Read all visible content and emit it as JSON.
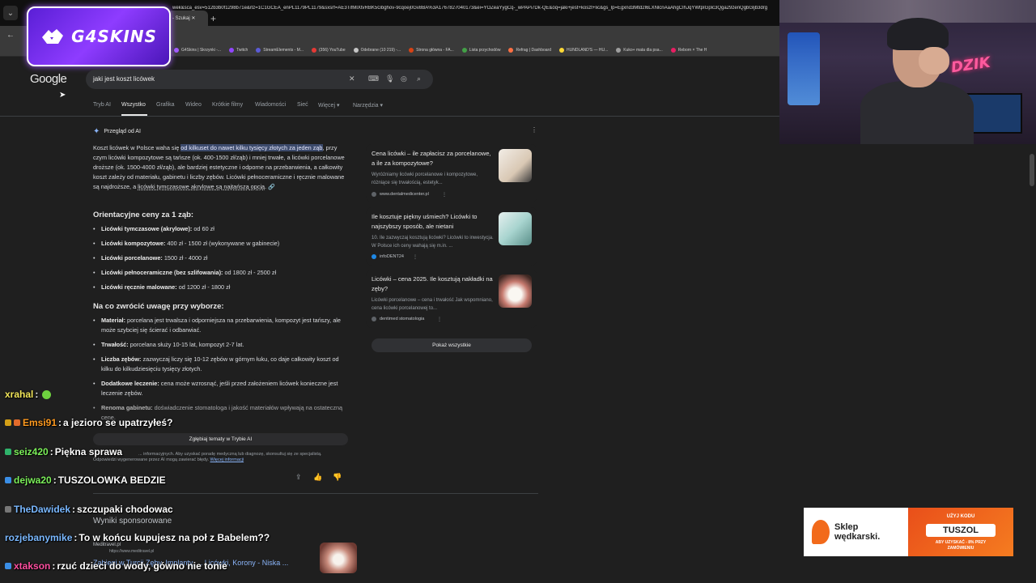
{
  "browser": {
    "tabs": [
      {
        "label": "- Szukaj"
      }
    ],
    "url": "wek&sca_esv=512b3b0f1298b71e&rlz=1C1GCEA_enPL1179PL1179&sxsrf=AE3TifMIXtvRBK5Gbghov-9cqoej0Gv8BA%3A1767827040173&ei=YOZeaYygCq-_wPAPi7Dk-QE&oq=jaki+jest+koszt+lic&gs_lp=Egxnd3Mtd2l6LXNlcnAaAhgCIhJqYWtpIGplc3Qga29zenQgbGljb3drg",
    "bookmarks": [
      "G4Skins | Skrzynki -...",
      "Twitch",
      "StreamElements - M...",
      "(356) YouTube",
      "Odebrane (10 219) -...",
      "Strona główna - FA...",
      "Lista przychodów",
      "Refrag | Dashboard",
      "HUNDLAND'S — HU...",
      "Kuko+ mata dla psa...",
      "Reborn × The H"
    ]
  },
  "overlay_brand": "G4SKINS",
  "google": {
    "logo": "Google",
    "query": "jaki jest koszt licówek",
    "tabs": [
      "Tryb AI",
      "Wszystko",
      "Grafika",
      "Wideo",
      "Krótkie filmy",
      "Wiadomości",
      "Sieć",
      "Więcej ▾",
      "Narzędzia ▾"
    ],
    "ai_overview": {
      "heading": "Przegląd od AI",
      "intro_a": "Koszt licówek w Polsce waha się ",
      "intro_hl": "od kilkuset do nawet kilku tysięcy złotych za jeden ząb",
      "intro_b": ", przy czym licówki kompozytowe są tańsze (ok. 400-1500 zł/ząb) i mniej trwałe, a licówki porcelanowe droższe (ok. 1500-4000 zł/ząb), ale bardziej estetyczne i odporne na przebarwienia, a całkowity koszt zależy od materiału, gabinetu i liczby zębów. Licówki pełnoceramiczne i ręcznie malowane są najdroższe, a ",
      "intro_ul": "licówki tymczasowe akrylowe są najtańszą opcją",
      "intro_c": ".",
      "h_prices": "Orientacyjne ceny za 1 ząb:",
      "prices": [
        {
          "name": "Licówki tymczasowe (akrylowe):",
          "value": " od 60 zł"
        },
        {
          "name": "Licówki kompozytowe:",
          "value": " 400 zł - 1500 zł (wykonywane w gabinecie)"
        },
        {
          "name": "Licówki porcelanowe:",
          "value": " 1500 zł - 4000 zł"
        },
        {
          "name": "Licówki pełnoceramiczne (bez szlifowania):",
          "value": " od 1800 zł - 2500 zł"
        },
        {
          "name": "Licówki ręcznie malowane:",
          "value": " od 1200 zł - 1800 zł"
        }
      ],
      "h_tips": "Na co zwrócić uwagę przy wyborze:",
      "tips": [
        {
          "name": "Materiał:",
          "value": " porcelana jest trwalsza i odporniejsza na przebarwienia, kompozyt jest tańszy, ale może szybciej się ścierać i odbarwiać."
        },
        {
          "name": "Trwałość:",
          "value": " porcelana służy 10-15 lat, kompozyt 2-7 lat."
        },
        {
          "name": "Liczba zębów:",
          "value": " zazwyczaj liczy się 10-12 zębów w górnym łuku, co daje całkowity koszt od kilku do kilkudziesięciu tysięcy złotych."
        },
        {
          "name": "Dodatkowe leczenie:",
          "value": " cena może wzrosnąć, jeśli przed założeniem licówek konieczne jest leczenie zębów."
        },
        {
          "name": "Renoma gabinetu:",
          "value": " doświadczenie stomatologa i jakość materiałów wpływają na ostateczną cenę."
        }
      ],
      "dive_button": "Zgłębiaj tematy w Trybie AI",
      "disclaimer_a": "... informacyjnych. Aby uzyskać poradę medyczną lub diagnozę, skonsultuj się ze specjalistą.",
      "disclaimer_b": "Odpowiedzi wygenerowane przez AI mogą zawierać błędy. ",
      "disclaimer_link": "Więcej informacji"
    },
    "sources": [
      {
        "title": "Cena licówki – ile zapłacisz za porcelanowe, a ile za kompozytowe?",
        "snippet": "Wyróżniamy licówki porcelanowe i kompozytowe, różniące się trwałością, estetyk...",
        "site": "www.dentalmedicenter.pl"
      },
      {
        "title": "Ile kosztuje piękny uśmiech? Licówki to najszybszy sposób, ale nietani",
        "snippet": "10. Ile zazwyczaj kosztują licówki? Licówki to inwestycja. W Polsce ich ceny wahają się m.in. ...",
        "site": "infoDENT24"
      },
      {
        "title": "Licówki – cena 2025. Ile kosztują nakładki na zęby?",
        "snippet": "Licówki porcelanowe – cena i trwałość Jak wspomniano, cena licówki porcelanowej to...",
        "site": "dentimed stomatologia"
      }
    ],
    "show_all": "Pokaż wszystkie",
    "sponsored": "Wyniki sponsorowane",
    "ad": {
      "site": "Meditravel.pl",
      "url": "https://www.meditravel.pl",
      "title": "Zabiegi w Turcji Zęby, Implanty, ... Licówki, Korony - Niska ..."
    }
  },
  "chat": [
    {
      "user": "xrahal",
      "text": "",
      "color": "#f2e65a",
      "emote": true
    },
    {
      "user": "Emsi91",
      "text": "a jezioro se upatrzyłeś?",
      "color": "#ff9a1f"
    },
    {
      "user": "seiz420",
      "text": "Piękna sprawa",
      "color": "#7cf05a"
    },
    {
      "user": "dejwa20",
      "text": "TUSZOLOWKA BEDZIE",
      "color": "#7cf05a"
    },
    {
      "user": "TheDawidek",
      "text": "szczupaki chodowac",
      "color": "#7ab8ff"
    },
    {
      "user": "rozjebanymike",
      "text": "To w końcu kupujesz na poł z Babelem??",
      "color": "#7ab8ff"
    },
    {
      "user": "xtakson",
      "text": "rzuć dzieci do wody, gówno nie tonie",
      "color": "#ff4fa0"
    }
  ],
  "banner": {
    "brand_line1": "Sklep",
    "brand_line2": "wędkarski.",
    "use_code": "UŻYJ KODU",
    "code": "TUSZOL",
    "promo_line1": "ABY UZYSKAĆ - 8% PRZY",
    "promo_line2": "ZAMÓWIENIU"
  },
  "colors": {
    "accent": "#8ab4f8",
    "highlight": "#3c4a6b",
    "brand_purple": "#8e3cff",
    "banner_orange": "#f26a1b"
  }
}
